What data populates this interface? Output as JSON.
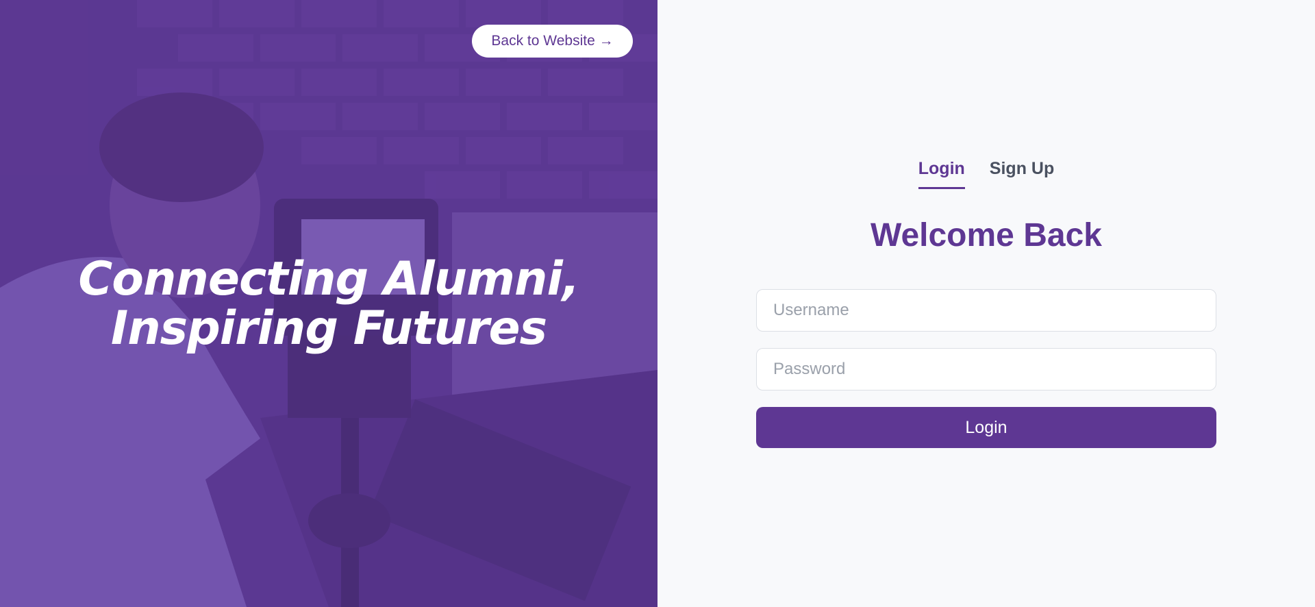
{
  "hero": {
    "back_button": "Back to Website →",
    "tagline_line1": "Connecting Alumni,",
    "tagline_line2": "Inspiring Futures",
    "overlay_color": "#6840a8"
  },
  "auth": {
    "tabs": [
      {
        "label": "Login",
        "active": true
      },
      {
        "label": "Sign Up",
        "active": false
      }
    ],
    "heading": "Welcome Back",
    "username_placeholder": "Username",
    "password_placeholder": "Password",
    "submit_label": "Login",
    "accent_color": "#5e3793"
  }
}
